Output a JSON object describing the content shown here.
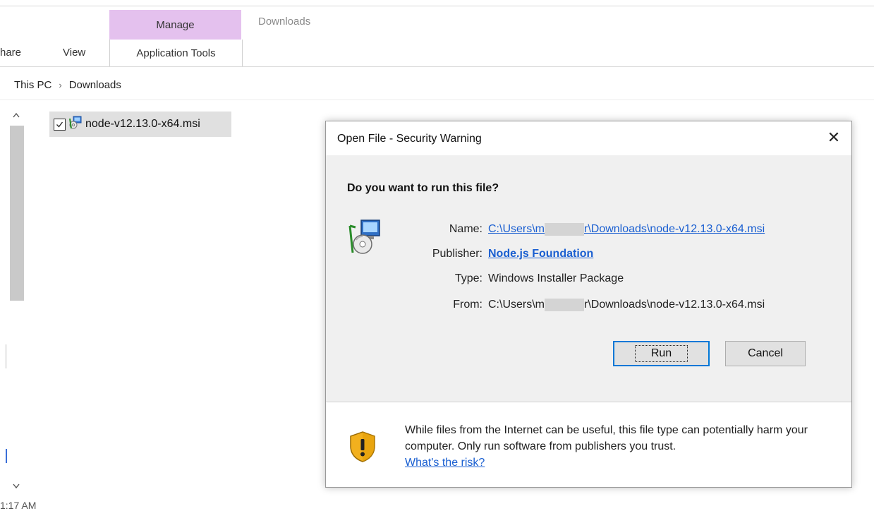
{
  "ribbon": {
    "manage_tab": "Manage",
    "window_title": "Downloads",
    "tabs": [
      "hare",
      "View"
    ],
    "app_tools_tab": "Application Tools"
  },
  "breadcrumb": [
    "This PC",
    "Downloads"
  ],
  "breadcrumb_separator": "›",
  "file_item": {
    "name": "node-v12.13.0-x64.msi"
  },
  "bottom_fragment": "1:17 AM",
  "dialog": {
    "title": "Open File - Security Warning",
    "close_glyph": "✕",
    "question": "Do you want to run this file?",
    "fields": {
      "name_label": "Name:",
      "name_value_start": "C:\\Users\\m",
      "name_value_end": "r\\Downloads\\node-v12.13.0-x64.msi",
      "publisher_label": "Publisher:",
      "publisher_value": "Node.js Foundation",
      "type_label": "Type:",
      "type_value": "Windows Installer Package",
      "from_label": "From:",
      "from_value_start": "C:\\Users\\m",
      "from_value_end": "r\\Downloads\\node-v12.13.0-x64.msi"
    },
    "buttons": {
      "run": "Run",
      "cancel": "Cancel"
    },
    "warning_text": "While files from the Internet can be useful, this file type can potentially harm your computer. Only run software from publishers you trust.",
    "risk_link": "What's the risk?"
  },
  "colors": {
    "manage_tab": "#e4c1ee",
    "link": "#1a5fd1",
    "run_button_border": "#0078d7"
  },
  "icons": {
    "installer": "installer-icon",
    "shield": "shield-warning-icon",
    "file": "msi-file-icon"
  }
}
